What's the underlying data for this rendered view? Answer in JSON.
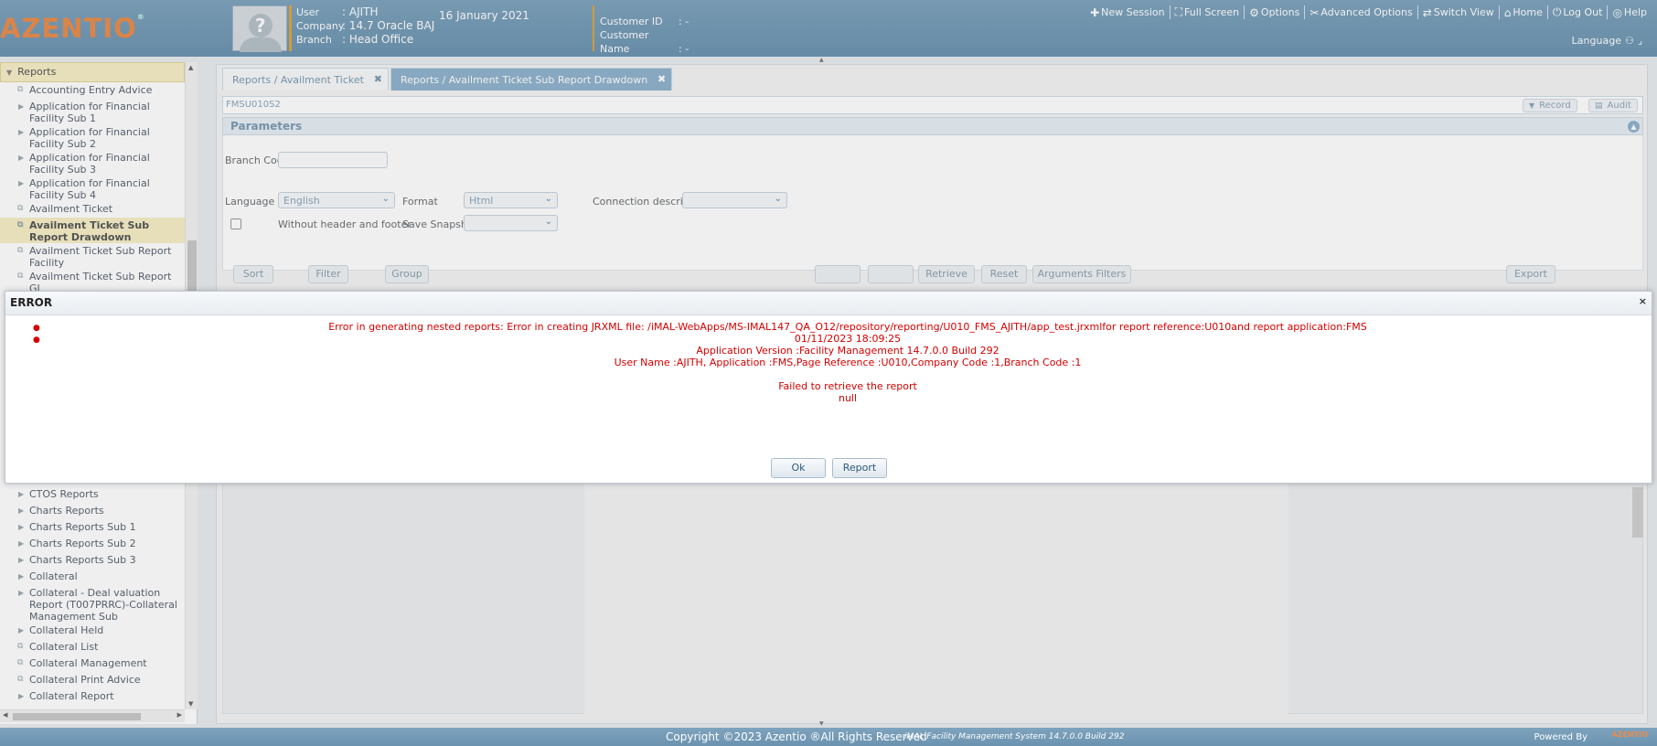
{
  "header": {
    "logo": "AZENTIO",
    "logo_mark": "®",
    "user_label": "User",
    "user_value": ": AJITH",
    "company_label": "Company",
    "company_value": ": 14.7 Oracle BAJ",
    "branch_label": "Branch",
    "branch_value": ": Head Office",
    "date": "16 January 2021",
    "customer_id_label": "Customer ID",
    "customer_id_value": ":  -",
    "customer_name_label": "Customer Name",
    "customer_name_value": ": -",
    "links": [
      "New Session",
      "Full Screen",
      "Options",
      "Advanced Options",
      "Switch View",
      "Home",
      "Log Out",
      "Help"
    ],
    "language_label": "Language"
  },
  "sidebar": {
    "root": "Reports",
    "items_top": [
      {
        "label": "Accounting Entry Advice",
        "kind": "leaf"
      },
      {
        "label": "Application for Financial Facility Sub 1",
        "kind": "node"
      },
      {
        "label": "Application for Financial Facility Sub 2",
        "kind": "node"
      },
      {
        "label": "Application for Financial Facility Sub 3",
        "kind": "node"
      },
      {
        "label": "Application for Financial Facility Sub 4",
        "kind": "node"
      },
      {
        "label": "Availment Ticket",
        "kind": "leaf"
      },
      {
        "label": "Availment Ticket Sub Report Drawdown",
        "kind": "leaf",
        "active": true
      },
      {
        "label": "Availment Ticket Sub Report Facility",
        "kind": "leaf"
      },
      {
        "label": "Availment Ticket Sub Report GL",
        "kind": "leaf"
      }
    ],
    "items_bottom": [
      {
        "label": "CTOS Reports",
        "kind": "node"
      },
      {
        "label": "Charts Reports",
        "kind": "node"
      },
      {
        "label": "Charts Reports Sub 1",
        "kind": "node"
      },
      {
        "label": "Charts Reports Sub 2",
        "kind": "node"
      },
      {
        "label": "Charts Reports Sub 3",
        "kind": "node"
      },
      {
        "label": "Collateral",
        "kind": "node"
      },
      {
        "label": "Collateral - Deal valuation Report (T007PRRC)-Collateral Management Sub",
        "kind": "node"
      },
      {
        "label": "Collateral Held",
        "kind": "node"
      },
      {
        "label": "Collateral List",
        "kind": "leaf"
      },
      {
        "label": "Collateral Management",
        "kind": "leaf"
      },
      {
        "label": "Collateral Print Advice",
        "kind": "leaf"
      },
      {
        "label": "Collateral Report",
        "kind": "node"
      }
    ]
  },
  "tabs": [
    {
      "label": "Reports / Availment Ticket",
      "close": "✖"
    },
    {
      "label": "Reports / Availment Ticket Sub Report Drawdown",
      "close": "✖"
    }
  ],
  "screen": {
    "code": "FMSU010S2",
    "record_label": "Record",
    "audit_label": "Audit"
  },
  "params": {
    "title": "Parameters",
    "branch_code_label": "Branch Code",
    "branch_code_value": "",
    "language_label": "Language",
    "language_value": "English",
    "format_label": "Format",
    "format_value": "Html",
    "connection_label": "Connection description",
    "connection_value": "",
    "without_header_label": "Without header and footer",
    "save_snapshot_label": "Save Snapshot",
    "save_snapshot_value": ""
  },
  "actions": {
    "sort": "Sort",
    "filter": "Filter",
    "group": "Group",
    "blank1": "",
    "blank2": "",
    "retrieve": "Retrieve",
    "reset": "Reset",
    "arguments_filters": "Arguments Filters",
    "export": "Export"
  },
  "dialog": {
    "title": "ERROR",
    "close": "×",
    "lines": [
      "Error in generating nested reports: Error in creating JRXML file: /iMAL-WebApps/MS-IMAL147_QA_O12/repository/reporting/U010_FMS_AJITH/app_test.jrxmlfor report reference:U010and report application:FMS",
      "01/11/2023 18:09:25",
      "Application Version :Facility Management 14.7.0.0 Build 292",
      "User Name :AJITH, Application :FMS,Page Reference :U010,Company Code :1,Branch Code :1",
      "",
      "Failed to retrieve the report",
      "null"
    ],
    "ok_label": "Ok",
    "report_label": "Report"
  },
  "footer": {
    "copyright": "Copyright ©2023 Azentio ®All Rights Reserved",
    "system": "iMAL Facility Management System 14.7.0.0 Build 292",
    "powered_by": "Powered By",
    "powered_logo": "AZENTIO"
  },
  "colors": {
    "header_bg": "#7ea3bd",
    "error_text": "#d40000",
    "active_item_bg": "#f6eec6",
    "logo": "#e98b4a"
  }
}
